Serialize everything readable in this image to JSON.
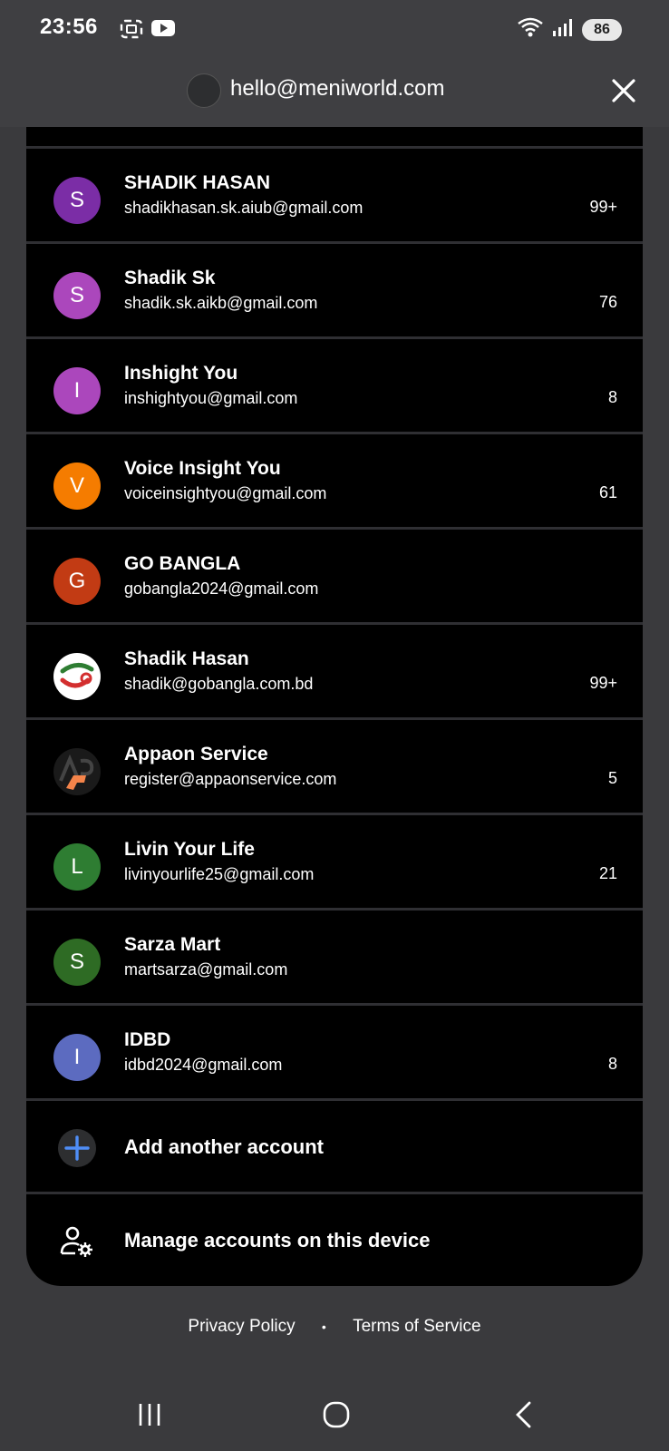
{
  "status_bar": {
    "time": "23:56",
    "battery": "86"
  },
  "header": {
    "email": "hello@meniworld.com"
  },
  "accounts": [
    {
      "name": "SHADIK HASAN",
      "email": "shadikhasan.sk.aiub@gmail.com",
      "count": "99+",
      "initial": "S",
      "color": "#7b2da6"
    },
    {
      "name": "Shadik Sk",
      "email": "shadik.sk.aikb@gmail.com",
      "count": "76",
      "initial": "S",
      "color": "#ab47bc"
    },
    {
      "name": "Inshight You",
      "email": "inshightyou@gmail.com",
      "count": "8",
      "initial": "I",
      "color": "#ab47bc"
    },
    {
      "name": "Voice Insight You",
      "email": "voiceinsightyou@gmail.com",
      "count": "61",
      "initial": "V",
      "color": "#f57c00"
    },
    {
      "name": "GO BANGLA",
      "email": "gobangla2024@gmail.com",
      "count": "",
      "initial": "G",
      "color": "#c23b14"
    },
    {
      "name": "Shadik Hasan",
      "email": "shadik@gobangla.com.bd",
      "count": "99+",
      "initial": "",
      "color": "#ffffff"
    },
    {
      "name": "Appaon Service",
      "email": "register@appaonservice.com",
      "count": "5",
      "initial": "",
      "color": "#1a1a1a"
    },
    {
      "name": "Livin Your Life",
      "email": "livinyourlife25@gmail.com",
      "count": "21",
      "initial": "L",
      "color": "#2e7d32"
    },
    {
      "name": "Sarza Mart",
      "email": "martsarza@gmail.com",
      "count": "",
      "initial": "S",
      "color": "#2e6b24"
    },
    {
      "name": "IDBD",
      "email": "idbd2024@gmail.com",
      "count": "8",
      "initial": "I",
      "color": "#5c6bc0"
    }
  ],
  "actions": {
    "add_account": "Add another account",
    "manage_accounts": "Manage accounts on this device"
  },
  "footer": {
    "privacy": "Privacy Policy",
    "separator": "•",
    "terms": "Terms of Service"
  },
  "colors": {
    "accent_blue": "#4f8ef7",
    "sheet_bg": "#000000",
    "page_bg": "#3a3a3d"
  }
}
